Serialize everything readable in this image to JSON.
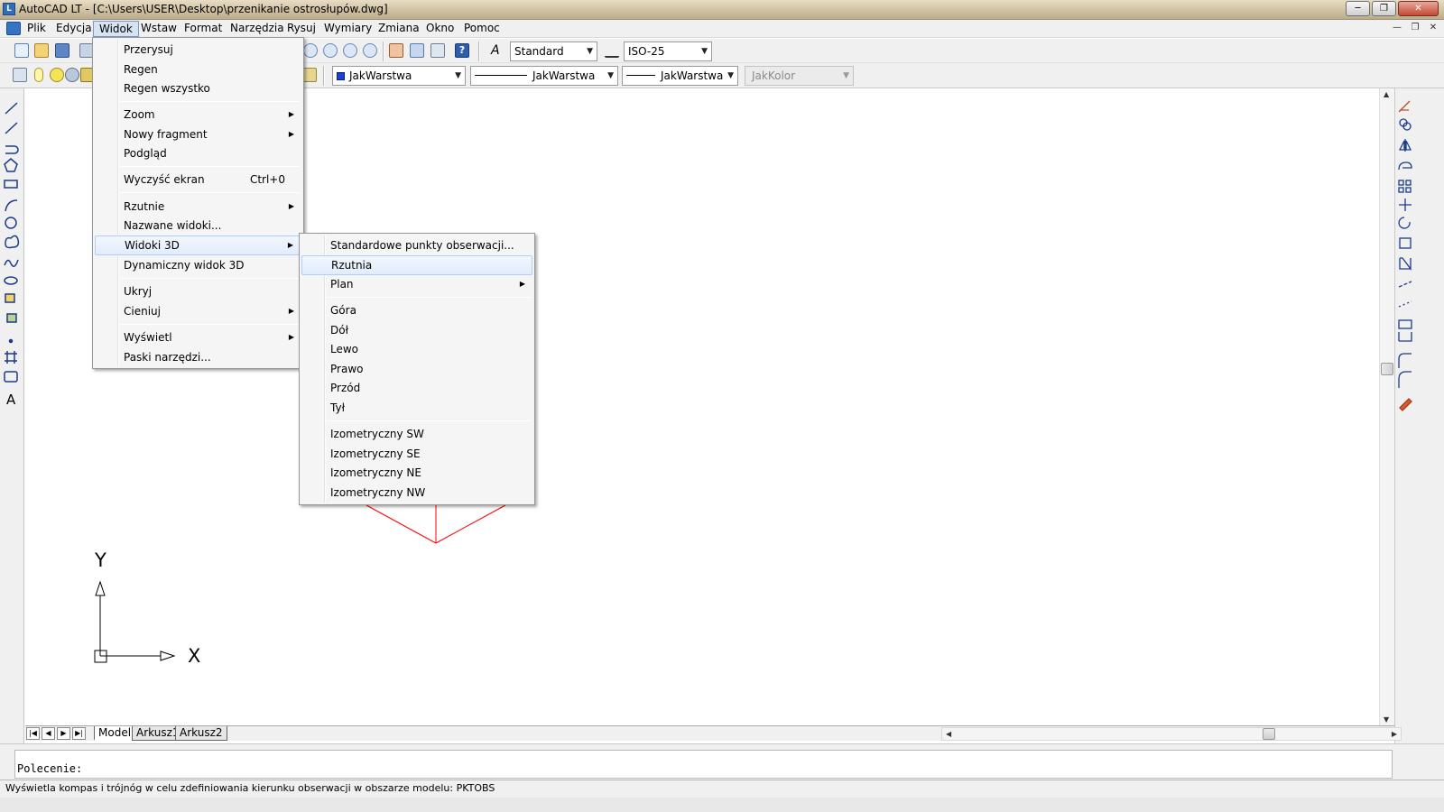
{
  "window": {
    "title": "AutoCAD LT - [C:\\Users\\USER\\Desktop\\przenikanie ostrosłupów.dwg]"
  },
  "menubar": {
    "items": [
      "Plik",
      "Edycja",
      "Widok",
      "Wstaw",
      "Format",
      "Narzędzia",
      "Rysuj",
      "Wymiary",
      "Zmiana",
      "Okno",
      "Pomoc"
    ],
    "active": "Widok"
  },
  "toolbar": {
    "text_style": "Standard",
    "dim_style": "ISO-25",
    "color": "JakWarstwa",
    "linetype": "JakWarstwa",
    "lineweight": "JakWarstwa",
    "plot_style": "JakKolor"
  },
  "widok_menu": {
    "items": [
      {
        "label": "Przerysuj"
      },
      {
        "label": "Regen"
      },
      {
        "label": "Regen wszystko"
      },
      {
        "label": "Zoom",
        "submenu": true
      },
      {
        "label": "Nowy fragment",
        "submenu": true
      },
      {
        "label": "Podgląd"
      },
      {
        "label": "Wyczyść ekran",
        "shortcut": "Ctrl+0"
      },
      {
        "label": "Rzutnie",
        "submenu": true
      },
      {
        "label": "Nazwane widoki..."
      },
      {
        "label": "Widoki 3D",
        "submenu": true
      },
      {
        "label": "Dynamiczny widok 3D"
      },
      {
        "label": "Ukryj"
      },
      {
        "label": "Cieniuj",
        "submenu": true
      },
      {
        "label": "Wyświetl",
        "submenu": true
      },
      {
        "label": "Paski narzędzi..."
      }
    ]
  },
  "widoki3d_menu": {
    "items": [
      {
        "label": "Standardowe punkty obserwacji..."
      },
      {
        "label": "Rzutnia"
      },
      {
        "label": "Plan",
        "submenu": true
      },
      {
        "label": "Góra"
      },
      {
        "label": "Dół"
      },
      {
        "label": "Lewo"
      },
      {
        "label": "Prawo"
      },
      {
        "label": "Przód"
      },
      {
        "label": "Tył"
      },
      {
        "label": "Izometryczny SW"
      },
      {
        "label": "Izometryczny SE"
      },
      {
        "label": "Izometryczny NE"
      },
      {
        "label": "Izometryczny NW"
      }
    ]
  },
  "ucs": {
    "x_label": "X",
    "y_label": "Y"
  },
  "layout_tabs": [
    "Model",
    "Arkusz1",
    "Arkusz2"
  ],
  "command_line": {
    "prompt": "Polecenie:"
  },
  "status_text": "Wyświetla kompas i trójnóg w celu zdefiniowania kierunku obserwacji w obszarze modelu:  PKTOBS",
  "colors": {
    "drawing_lines": "#ff0000",
    "menu_highlight": "#aecff7"
  }
}
